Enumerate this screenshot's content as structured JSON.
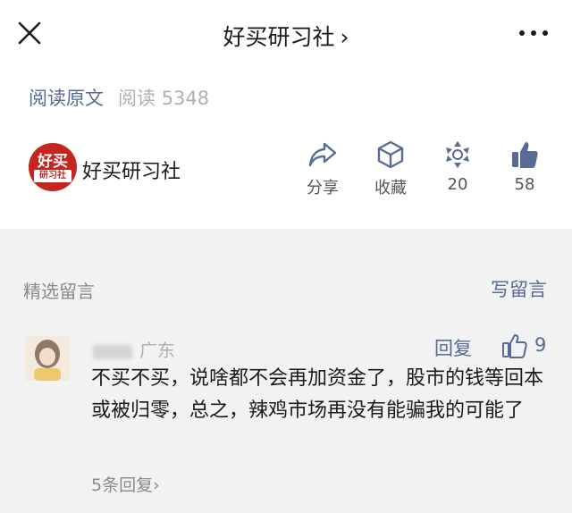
{
  "header": {
    "title": "好买研习社",
    "title_chevron": "›"
  },
  "meta": {
    "read_original": "阅读原文",
    "reads_label": "阅读",
    "reads_count": "5348"
  },
  "account": {
    "logo_text_top": "好买",
    "logo_text_bottom": "研习社",
    "name": "好买研习社"
  },
  "actions": {
    "share_label": "分享",
    "favorite_label": "收藏",
    "wow_count": "20",
    "like_count": "58"
  },
  "comments": {
    "section_title": "精选留言",
    "write_label": "写留言",
    "items": [
      {
        "location": "广东",
        "reply_label": "回复",
        "likes": "9",
        "text": "不买不买，说啥都不会再加资金了，股市的钱等回本或被归零，总之，辣鸡市场再没有能骗我的可能了",
        "replies_link": "5条回复›"
      }
    ]
  },
  "colors": {
    "link": "#576b95",
    "logo_red": "#c3261f",
    "comments_bg": "#f2f2f2"
  },
  "icons": [
    "close-icon",
    "more-icon",
    "share-icon",
    "favorite-icon",
    "wow-icon",
    "thumbs-up-icon"
  ]
}
